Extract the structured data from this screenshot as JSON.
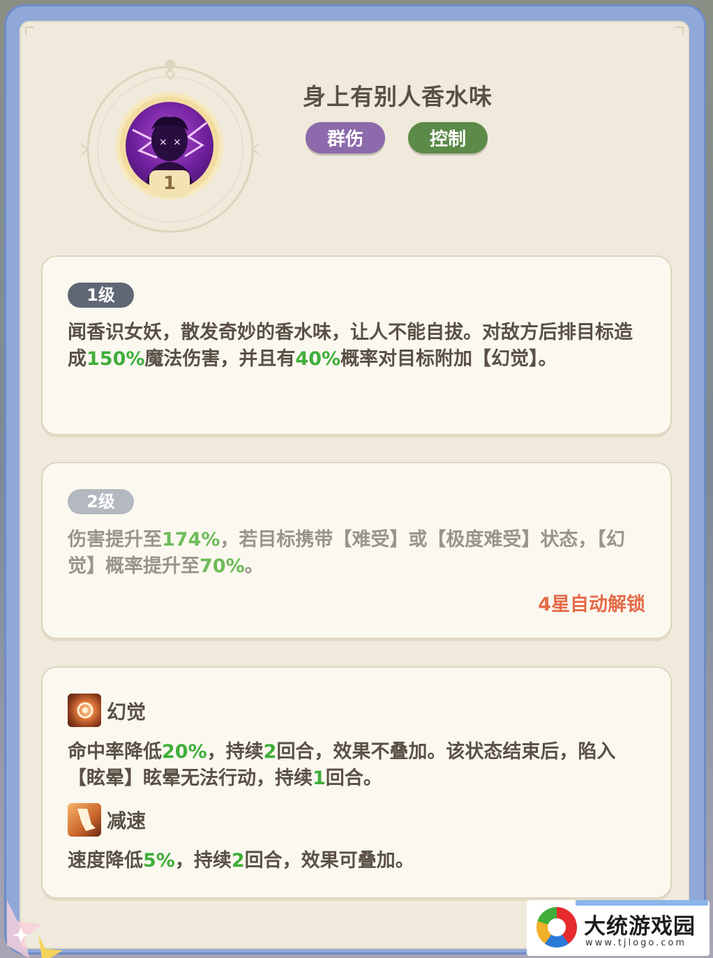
{
  "skill": {
    "title": "身上有别人香水味",
    "level": "1",
    "tags": [
      {
        "label": "群伤",
        "color": "#8c6aab"
      },
      {
        "label": "控制",
        "color": "#5c8a48"
      }
    ]
  },
  "levels": [
    {
      "badge": "1级",
      "parts": [
        "闻香识女妖，散发奇妙的香水味，让人不能自拔。对敌方后排目标造成",
        "150%",
        "魔法伤害，并且有",
        "40%",
        "概率对目标附加【幻觉】。"
      ]
    },
    {
      "badge": "2级",
      "parts": [
        "伤害提升至",
        "174%",
        "，若目标携带【难受】或【极度难受】状态，【幻觉】概率提升至",
        "70%",
        "。"
      ],
      "unlock": "4星自动解锁"
    }
  ],
  "effects": [
    {
      "name": "幻觉",
      "icon": "illusion-icon",
      "parts": [
        "命中率降低",
        "20%",
        "，持续",
        "2",
        "回合，效果不叠加。该状态结束后，陷入【眩晕】眩晕无法行动，持续",
        "1",
        "回合。"
      ]
    },
    {
      "name": "减速",
      "icon": "slow-icon",
      "parts": [
        "速度降低",
        "5%",
        "，持续",
        "2",
        "回合，效果可叠加。"
      ]
    }
  ],
  "watermark": {
    "name": "大统游戏园",
    "url": "www.tjlogo.com"
  },
  "colors": {
    "highlight": "#3fae3a",
    "unlock": "#e56b48",
    "panel": "#efeadb"
  }
}
